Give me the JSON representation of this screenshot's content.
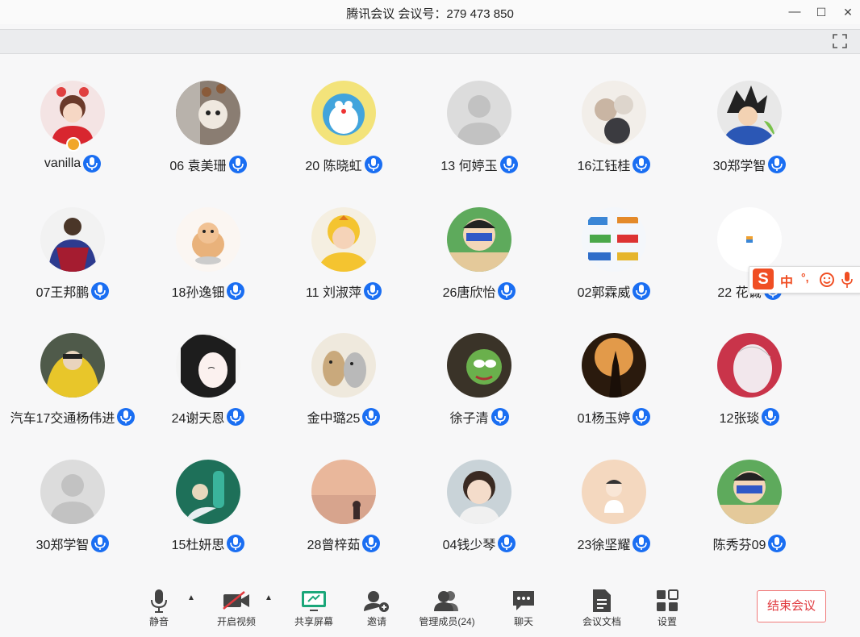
{
  "window": {
    "title": "腾讯会议 会议号：279 473 850",
    "minimize": "—",
    "maximize": "☐",
    "close": "✕"
  },
  "participants": [
    {
      "name": "vanilla",
      "avatar": "girl-red-sweater",
      "host": true
    },
    {
      "name": "06 袁美珊",
      "avatar": "dogs-photo"
    },
    {
      "name": "20 陈晓虹",
      "avatar": "doraemon"
    },
    {
      "name": "13 何婷玉",
      "avatar": "default"
    },
    {
      "name": "16江钰桂",
      "avatar": "cats-photo"
    },
    {
      "name": "30郑学智",
      "avatar": "anime-blue"
    },
    {
      "name": "07王邦鹏",
      "avatar": "basketball-player"
    },
    {
      "name": "18孙逸钿",
      "avatar": "hamster"
    },
    {
      "name": "11 刘淑萍",
      "avatar": "baby-duck"
    },
    {
      "name": "26唐欣怡",
      "avatar": "crayon-shin"
    },
    {
      "name": "02郭霖威",
      "avatar": "vehicles"
    },
    {
      "name": "22 花诚",
      "avatar": "blank-white"
    },
    {
      "name": "汽车17交通杨伟进",
      "avatar": "yellow-hoodie"
    },
    {
      "name": "24谢天恩",
      "avatar": "anime-girl-bw"
    },
    {
      "name": "金中璐25",
      "avatar": "cats-drawing"
    },
    {
      "name": "徐子清",
      "avatar": "pepe"
    },
    {
      "name": "01杨玉婷",
      "avatar": "silhouette"
    },
    {
      "name": "12张琰",
      "avatar": "anime-veil"
    },
    {
      "name": "30郑学智",
      "avatar": "default"
    },
    {
      "name": "15杜妍思",
      "avatar": "cartoon-green"
    },
    {
      "name": "28曾梓茹",
      "avatar": "sunset"
    },
    {
      "name": "04钱少琴",
      "avatar": "girl-photo"
    },
    {
      "name": "23徐坚耀",
      "avatar": "cartoon-boy"
    },
    {
      "name": "陈秀芬09",
      "avatar": "crayon-shin"
    }
  ],
  "toolbar": {
    "mute": "静音",
    "video": "开启视频",
    "share": "共享屏幕",
    "invite": "邀请",
    "members": "管理成员(24)",
    "chat": "聊天",
    "docs": "会议文档",
    "settings": "设置",
    "end": "结束会议"
  },
  "ime": {
    "logo": "S",
    "mode": "中",
    "punct": "°,"
  },
  "colors": {
    "mic_blue": "#1a6ef2",
    "end_red": "#e0393e",
    "share_green": "#1ba77a"
  }
}
